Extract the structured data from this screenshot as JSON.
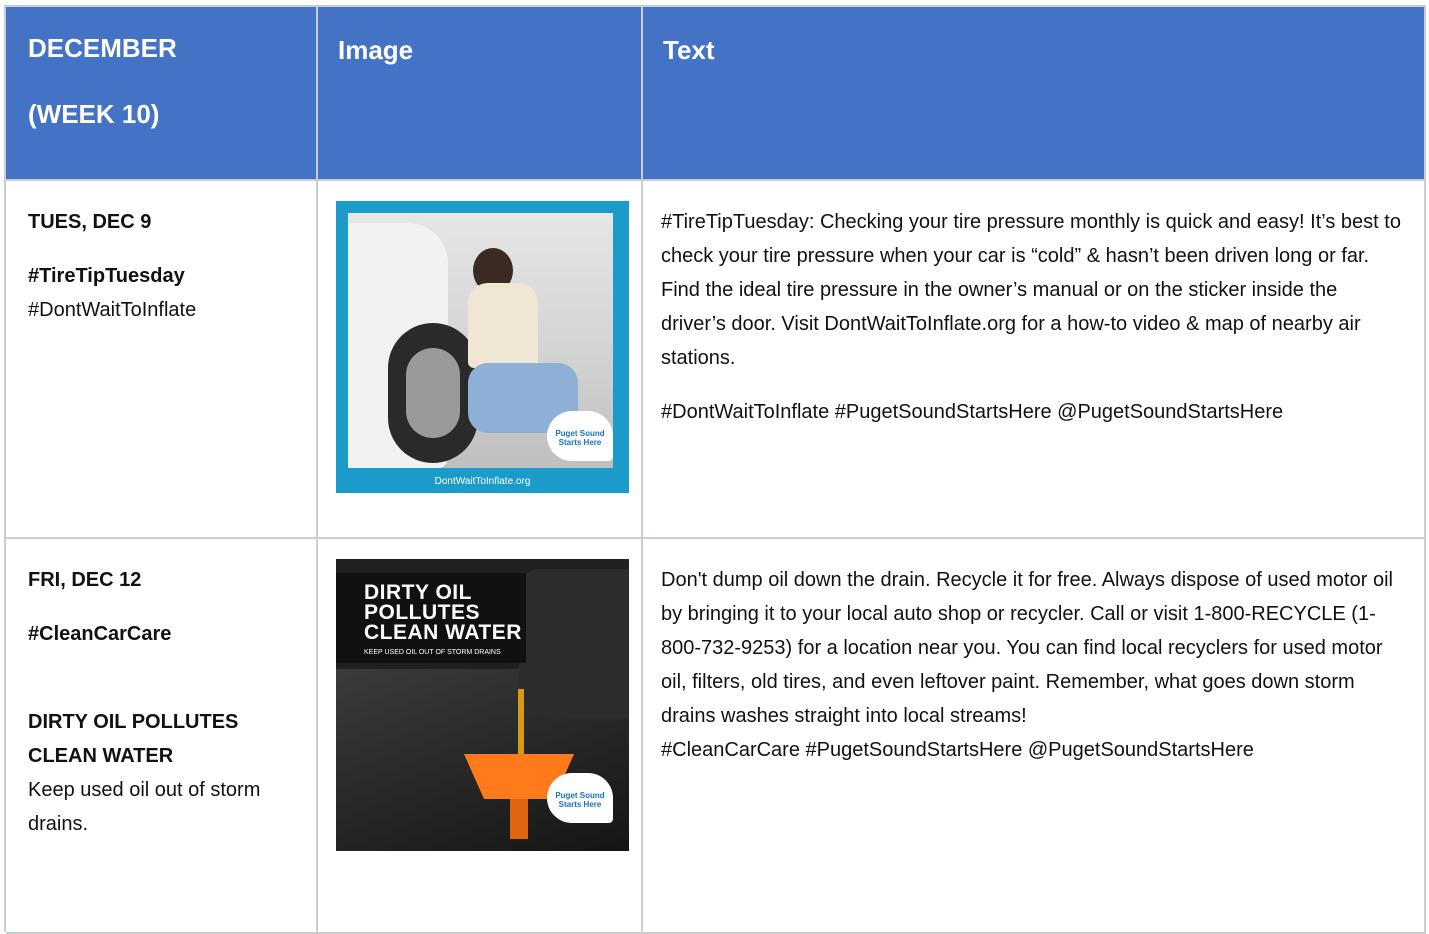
{
  "header": {
    "col1_line1": "DECEMBER",
    "col1_line2": "(WEEK 10)",
    "col2": "Image",
    "col3": "Text"
  },
  "rows": [
    {
      "date": "TUES, DEC 9",
      "tag_bold": "#TireTipTuesday",
      "tag_plain": "#DontWaitToInflate",
      "image": {
        "icon": "tire-pressure-photo",
        "url_text": "DontWaitToInflate.org",
        "logo_text": "Puget Sound Starts Here",
        "frame_color": "#1a9bc9"
      },
      "text_p1": "#TireTipTuesday: Checking your tire pressure monthly is quick and easy! It’s best to check your tire pressure when your car is “cold” & hasn’t been driven long or far. Find the ideal tire pressure in the owner’s manual or on the sticker inside the driver’s door. Visit DontWaitToInflate.org for a how-to video & map of nearby air stations.",
      "text_p2": "#DontWaitToInflate #PugetSoundStartsHere @PugetSoundStartsHere"
    },
    {
      "date": "FRI, DEC 12",
      "tag_bold": "#CleanCarCare",
      "headline": "DIRTY OIL POLLUTES CLEAN WATER",
      "subtext": "Keep used oil out of storm drains.",
      "image": {
        "icon": "oil-funnel-photo",
        "headline_lines": [
          "DIRTY OIL",
          "POLLUTES",
          "CLEAN WATER"
        ],
        "sub": "KEEP USED OIL OUT OF STORM DRAINS",
        "logo_text": "Puget Sound Starts Here"
      },
      "text_p1": "Don't dump oil down the drain. Recycle it for free. Always dispose of used motor oil by bringing it to your local auto shop or recycler. Call or visit 1-800-RECYCLE (1-800-732-9253) for a location near you. You can find local recyclers for used motor oil, filters, old tires, and even leftover paint. Remember, what goes down storm drains washes straight into local streams!",
      "text_p2": "#CleanCarCare #PugetSoundStartsHere @PugetSoundStartsHere"
    }
  ],
  "colors": {
    "header_bg": "#4472c4",
    "border": "#c9ced6"
  }
}
